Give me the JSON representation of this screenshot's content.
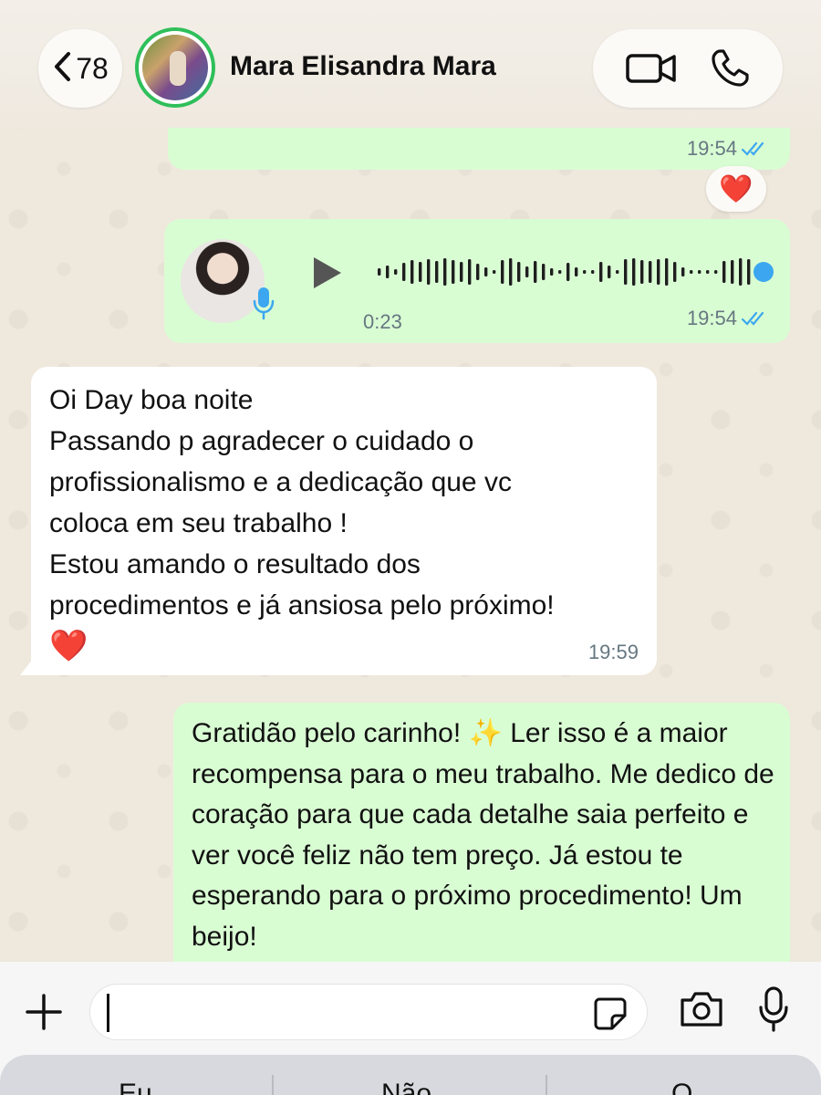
{
  "header": {
    "back_count": "78",
    "contact_name": "Mara Elisandra Mara"
  },
  "messages": {
    "top": {
      "time": "19:54"
    },
    "reaction": "❤️",
    "voice": {
      "duration": "0:23",
      "time": "19:54"
    },
    "incoming": {
      "text": "Oi Day boa noite\nPassando p agradecer o cuidado o\nprofissionalismo e a dedicação que vc\ncoloca em seu trabalho !\nEstou amando o resultado dos\nprocedimentos e já ansiosa pelo próximo!",
      "heart": "❤️",
      "time": "19:59"
    },
    "outgoing": {
      "text_a": "Gratidão pelo carinho! ",
      "sparkle": "✨",
      "text_b": " Ler isso é a maior recompensa para o meu trabalho. Me dedico de coração para que cada detalhe saia perfeito e ver você feliz não tem preço. Já estou te esperando para o próximo procedimento! Um beijo!"
    }
  },
  "composer": {
    "value": "",
    "placeholder": ""
  },
  "keyboard": {
    "suggestions": [
      "Eu",
      "Não",
      "O"
    ]
  },
  "colors": {
    "outgoing_bubble": "#d9fdd3",
    "incoming_bubble": "#ffffff",
    "read_ticks": "#3ca7f0",
    "online_ring": "#2fbf5a"
  }
}
